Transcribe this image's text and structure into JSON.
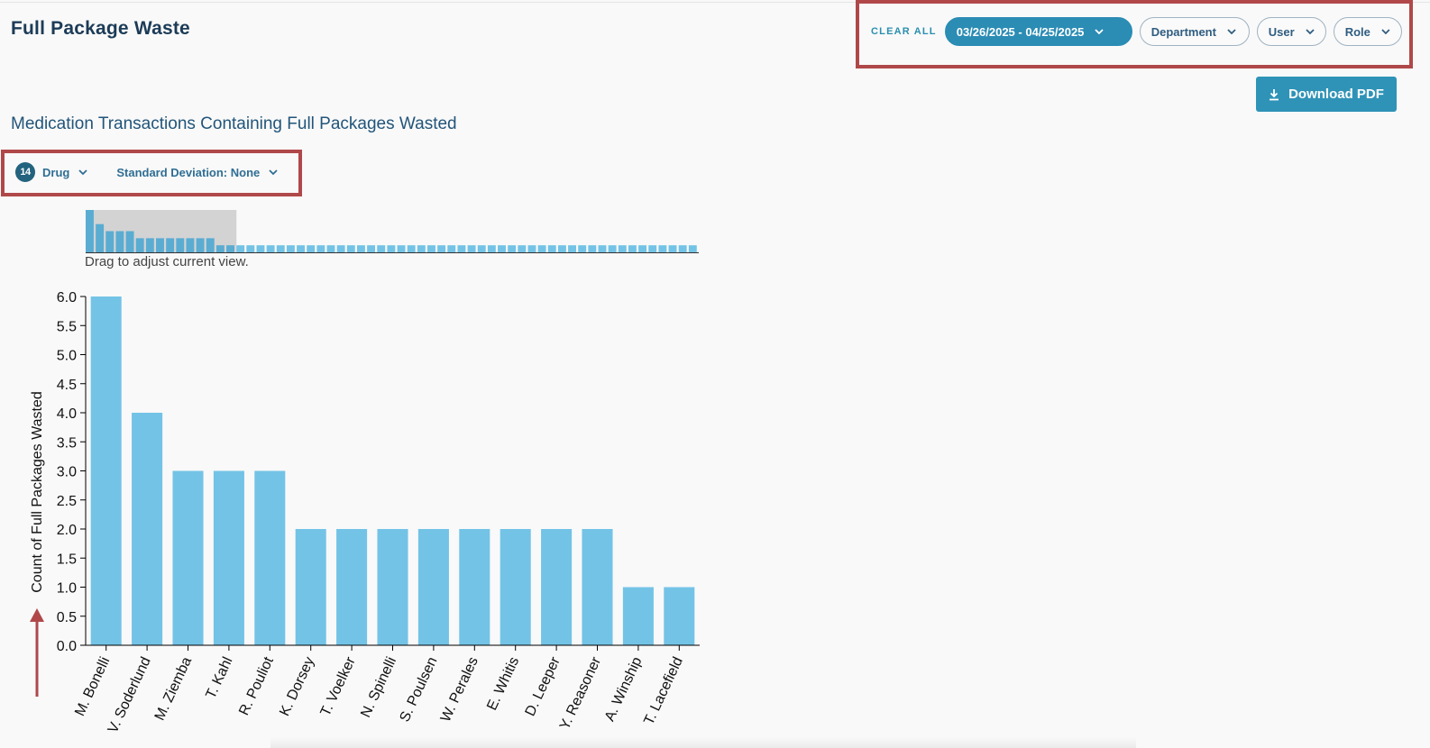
{
  "page": {
    "title": "Full Package Waste",
    "subtitle": "Medication Transactions Containing Full Packages Wasted"
  },
  "filters": {
    "clear_all": "CLEAR ALL",
    "date_range": "03/26/2025 - 04/25/2025",
    "department": "Department",
    "user": "User",
    "role": "Role"
  },
  "actions": {
    "download_pdf": "Download PDF",
    "download_icon": "download-icon"
  },
  "chart_controls": {
    "badge_count": "14",
    "drug_label": "Drug",
    "std_dev_label": "Standard Deviation: None"
  },
  "brush": {
    "hint": "Drag to adjust current view.",
    "overview_values": [
      6,
      4,
      3,
      3,
      3,
      2,
      2,
      2,
      2,
      2,
      2,
      2,
      2,
      1,
      1,
      1,
      1,
      1,
      1,
      1,
      1,
      1,
      1,
      1,
      1,
      1,
      1,
      1,
      1,
      1,
      1,
      1,
      1,
      1,
      1,
      1,
      1,
      1,
      1,
      1,
      1,
      1,
      1,
      1,
      1,
      1,
      1,
      1,
      1,
      1,
      1,
      1,
      1,
      1,
      1,
      1,
      1,
      1,
      1,
      1,
      1
    ],
    "selected_count": 15
  },
  "colors": {
    "bar": "#73c3e6",
    "overview_bar": "#5aacd2",
    "accent": "#2b8cb4",
    "highlight_box": "#b0484a",
    "title": "#1c3b57"
  },
  "chart_data": {
    "type": "bar",
    "categories": [
      "M. Bonelli",
      "V. Soderlund",
      "M. Ziemba",
      "T. Kahl",
      "R. Pouliot",
      "K. Dorsey",
      "T. Voelker",
      "N. Spinelli",
      "S. Poulsen",
      "W. Perales",
      "E. Whitis",
      "D. Leeper",
      "Y. Reasoner",
      "A. Winship",
      "T. Lacefield"
    ],
    "values": [
      6,
      4,
      3,
      3,
      3,
      2,
      2,
      2,
      2,
      2,
      2,
      2,
      2,
      1,
      1
    ],
    "ylabel": "Count of Full Packages Wasted",
    "xlabel": "",
    "ylim": [
      0,
      6
    ],
    "yticks": [
      "0.0",
      "0.5",
      "1.0",
      "1.5",
      "2.0",
      "2.5",
      "3.0",
      "3.5",
      "4.0",
      "4.5",
      "5.0",
      "5.5",
      "6.0"
    ],
    "grid": false
  }
}
